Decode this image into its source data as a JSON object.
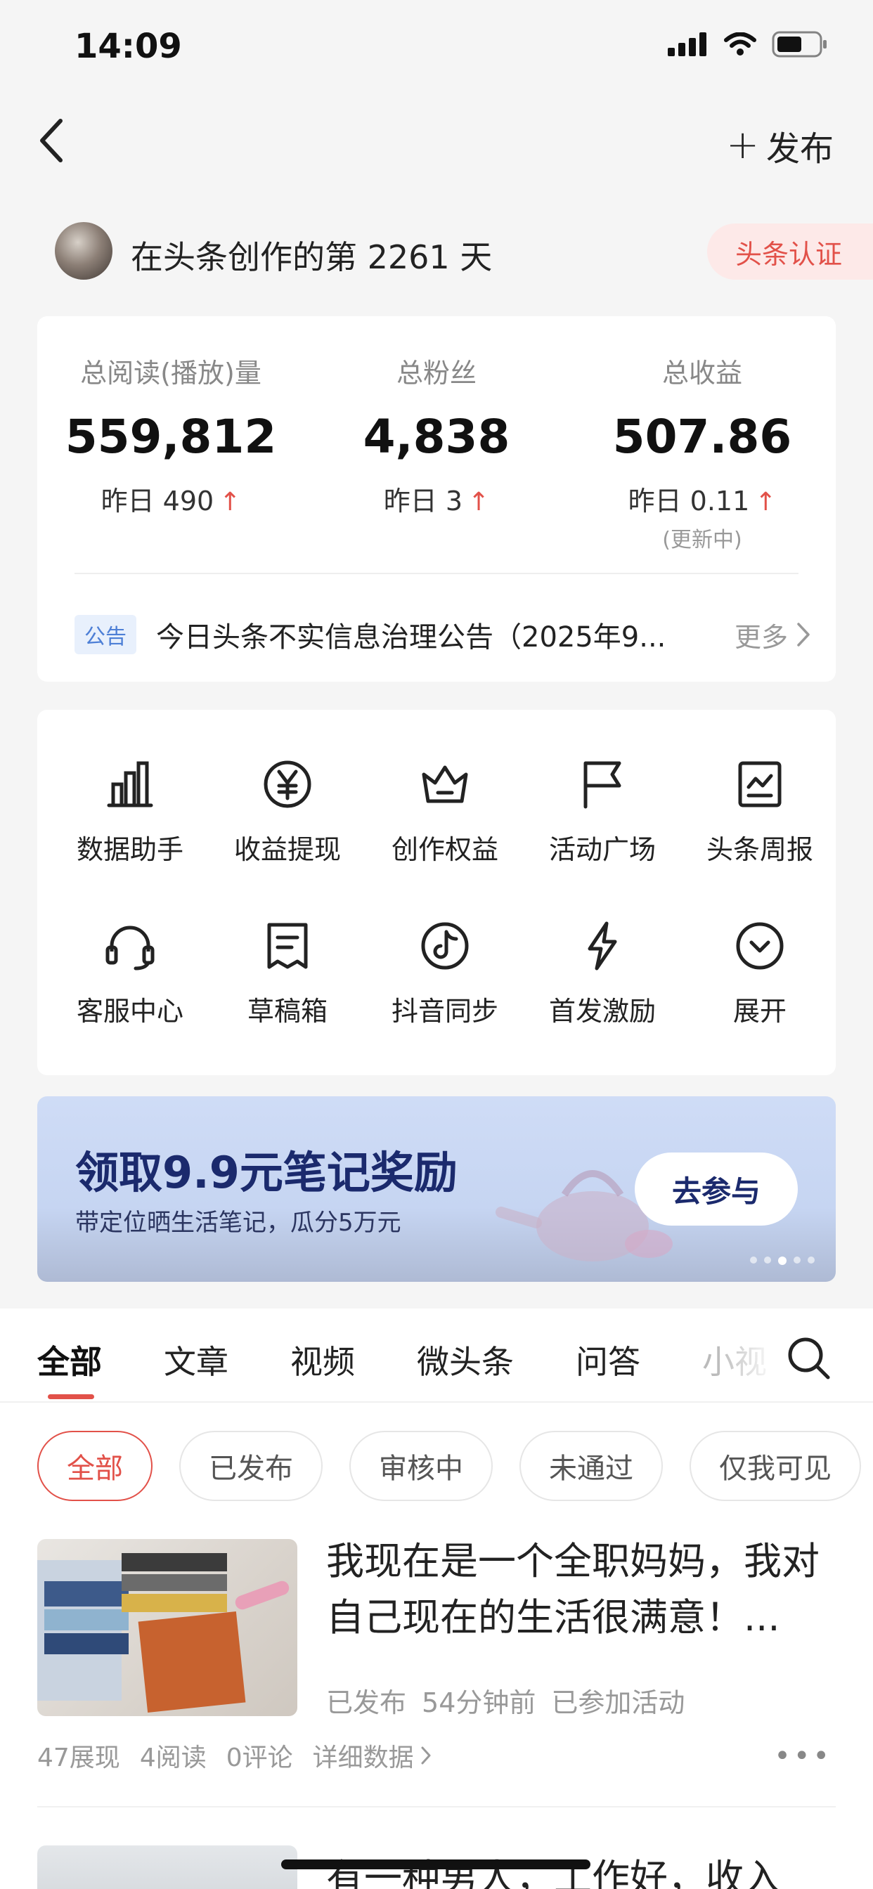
{
  "status_bar": {
    "time": "14:09"
  },
  "nav": {
    "publish_plus": "+",
    "publish_label": "发布"
  },
  "creator": {
    "days_text": "在头条创作的第 2261 天",
    "cert_label": "头条认证"
  },
  "stats": [
    {
      "label": "总阅读(播放)量",
      "value": "559,812",
      "delta": "昨日 490",
      "note": ""
    },
    {
      "label": "总粉丝",
      "value": "4,838",
      "delta": "昨日 3",
      "note": ""
    },
    {
      "label": "总收益",
      "value": "507.86",
      "delta": "昨日 0.11",
      "note": "(更新中)"
    }
  ],
  "notice": {
    "tag": "公告",
    "text": "今日头条不实信息治理公告（2025年9...",
    "more": "更多"
  },
  "tools": [
    {
      "label": "数据助手",
      "icon": "bar-chart-icon"
    },
    {
      "label": "收益提现",
      "icon": "yen-icon"
    },
    {
      "label": "创作权益",
      "icon": "crown-icon"
    },
    {
      "label": "活动广场",
      "icon": "flag-icon"
    },
    {
      "label": "头条周报",
      "icon": "report-icon"
    },
    {
      "label": "客服中心",
      "icon": "headset-icon"
    },
    {
      "label": "草稿箱",
      "icon": "draft-icon"
    },
    {
      "label": "抖音同步",
      "icon": "douyin-icon"
    },
    {
      "label": "首发激励",
      "icon": "lightning-icon"
    },
    {
      "label": "展开",
      "icon": "chevron-down-icon"
    }
  ],
  "banner": {
    "title": "领取9.9元笔记奖励",
    "subtitle": "带定位晒生活笔记，瓜分5万元",
    "button": "去参与",
    "slide_count": 5,
    "active_slide": 3
  },
  "tabs": [
    "全部",
    "文章",
    "视频",
    "微头条",
    "问答",
    "小视"
  ],
  "filters": [
    "全部",
    "已发布",
    "审核中",
    "未通过",
    "仅我可见"
  ],
  "articles": [
    {
      "title": "我现在是一个全职妈妈，我对自己现在的生活很满意！...",
      "meta": [
        "已发布",
        "54分钟前",
        "已参加活动"
      ],
      "stats": [
        "47展现",
        "4阅读",
        "0评论"
      ],
      "detail_link": "详细数据"
    },
    {
      "title": "有一种男人，工作好，收入"
    }
  ],
  "colors": {
    "accent": "#e25149",
    "banner_text": "#1b2a6d",
    "notice_tag": "#4d7fd6"
  }
}
